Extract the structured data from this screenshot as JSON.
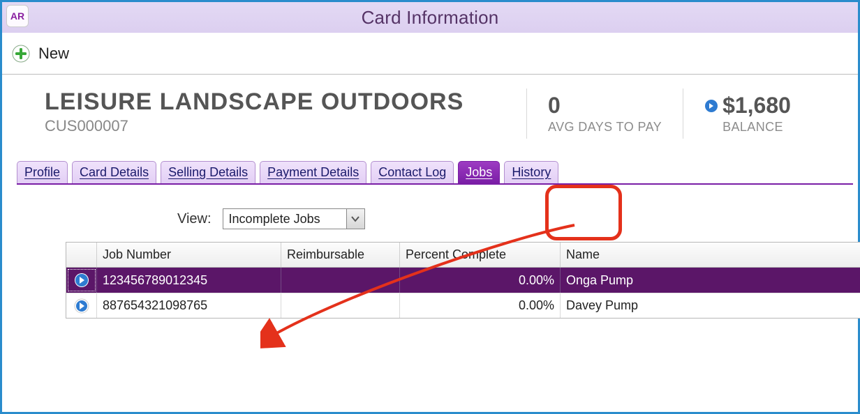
{
  "window": {
    "title": "Card Information",
    "app_badge": "AR"
  },
  "toolbar": {
    "new_label": "New"
  },
  "card": {
    "name": "LEISURE LANDSCAPE OUTDOORS",
    "code": "CUS000007",
    "avg_days_value": "0",
    "avg_days_label": "AVG DAYS TO PAY",
    "balance_value": "$1,680",
    "balance_label": "BALANCE"
  },
  "tabs": {
    "profile": "Profile",
    "card_details": "Card Details",
    "selling_details": "Selling Details",
    "payment_details": "Payment Details",
    "contact_log": "Contact Log",
    "jobs": "Jobs",
    "history": "History"
  },
  "view": {
    "label": "View:",
    "selected": "Incomplete Jobs"
  },
  "grid": {
    "headers": {
      "job_number": "Job Number",
      "reimbursable": "Reimbursable",
      "percent_complete": "Percent Complete",
      "name": "Name"
    },
    "rows": [
      {
        "job_number": "123456789012345",
        "reimbursable": "",
        "percent_complete": "0.00%",
        "name": "Onga Pump",
        "selected": true
      },
      {
        "job_number": "887654321098765",
        "reimbursable": "",
        "percent_complete": "0.00%",
        "name": "Davey Pump",
        "selected": false
      }
    ]
  }
}
